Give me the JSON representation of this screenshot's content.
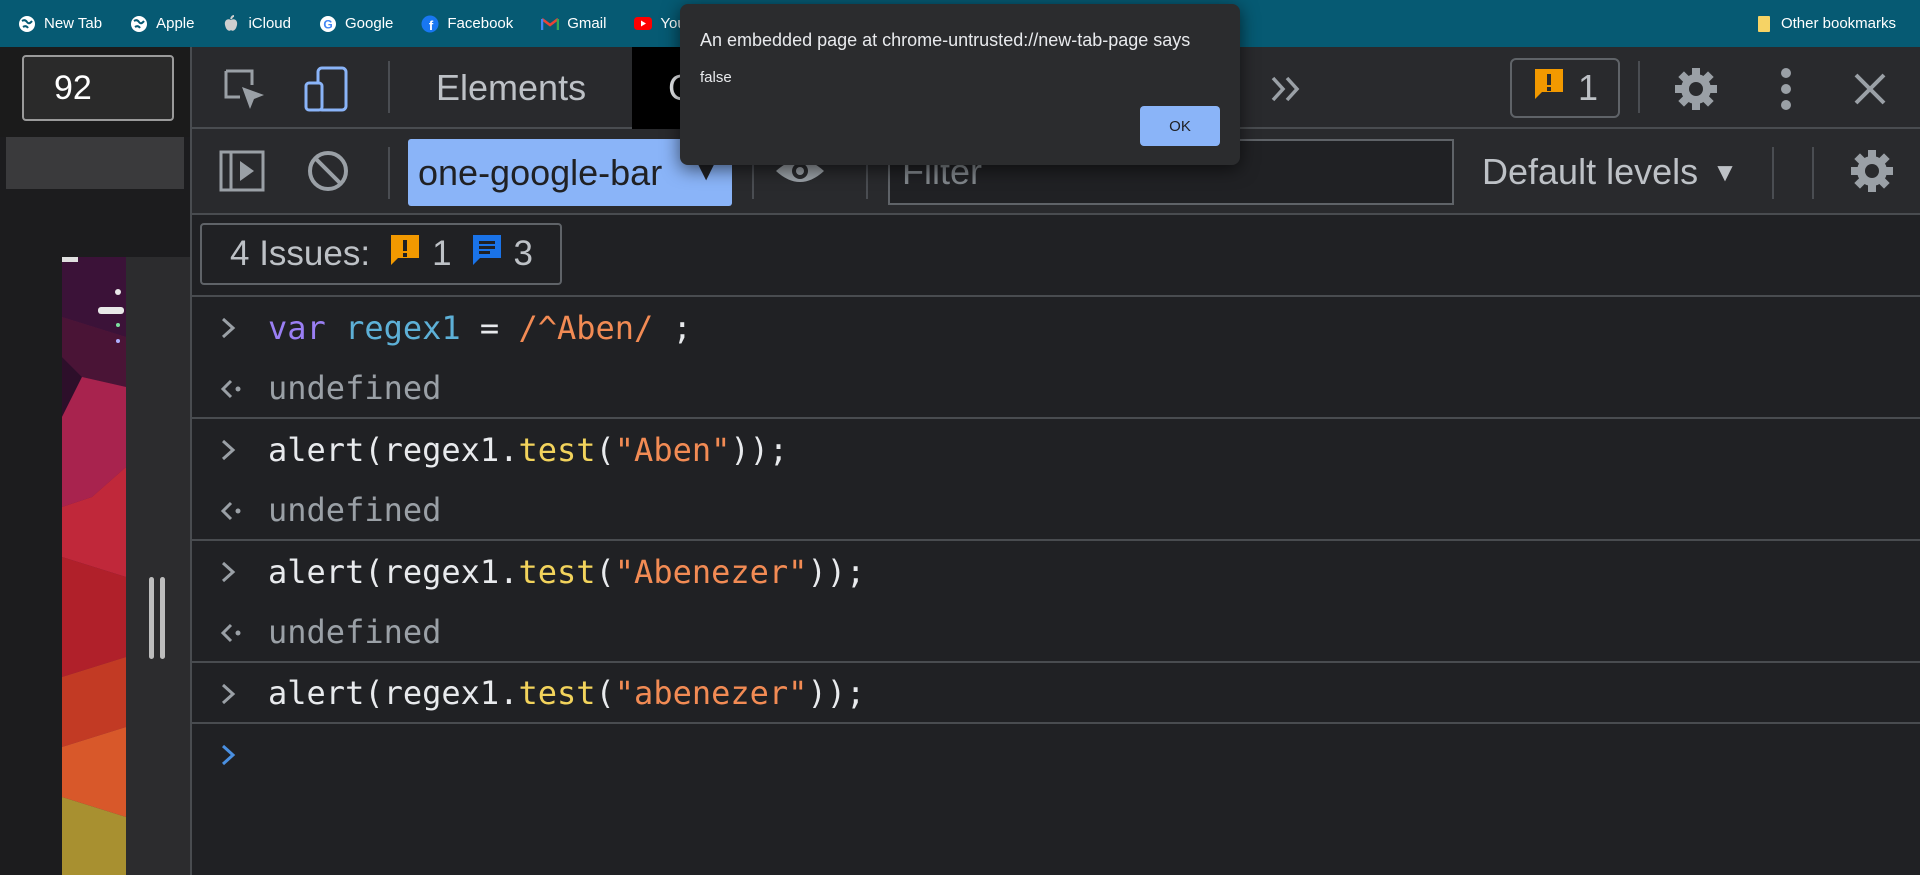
{
  "bookmarks": {
    "items": [
      {
        "label": "New Tab",
        "icon": "globe-icon"
      },
      {
        "label": "Apple",
        "icon": "globe-icon"
      },
      {
        "label": "iCloud",
        "icon": "apple-icon"
      },
      {
        "label": "Google",
        "icon": "google-icon"
      },
      {
        "label": "Facebook",
        "icon": "facebook-icon"
      },
      {
        "label": "Gmail",
        "icon": "gmail-icon"
      },
      {
        "label": "YouTu",
        "icon": "youtube-icon"
      }
    ],
    "other": "Other bookmarks"
  },
  "page": {
    "zoom_value": "92"
  },
  "devtools": {
    "tabs": [
      "Elements",
      "C"
    ],
    "issues_count": "1",
    "context": "one-google-bar",
    "filter_placeholder": "Filter",
    "levels_label": "Default levels",
    "issues_summary": {
      "label": "4 Issues:",
      "warnings": "1",
      "infos": "3"
    }
  },
  "console": {
    "entries": [
      {
        "type": "input",
        "tokens": [
          [
            "kw",
            "var"
          ],
          [
            "def",
            " "
          ],
          [
            "var",
            "regex1"
          ],
          [
            "def",
            " = "
          ],
          [
            "re",
            "/^Aben/"
          ],
          [
            "def",
            " ;"
          ]
        ]
      },
      {
        "type": "output",
        "text": "undefined"
      },
      {
        "type": "input",
        "tokens": [
          [
            "def",
            "alert(regex1."
          ],
          [
            "fn",
            "test"
          ],
          [
            "def",
            "("
          ],
          [
            "str",
            "\"Aben\""
          ],
          [
            "def",
            "));"
          ]
        ]
      },
      {
        "type": "output",
        "text": "undefined"
      },
      {
        "type": "input",
        "tokens": [
          [
            "def",
            "alert(regex1."
          ],
          [
            "fn",
            "test"
          ],
          [
            "def",
            "("
          ],
          [
            "str",
            "\"Abenezer\""
          ],
          [
            "def",
            "));"
          ]
        ]
      },
      {
        "type": "output",
        "text": "undefined"
      },
      {
        "type": "input",
        "tokens": [
          [
            "def",
            "alert(regex1."
          ],
          [
            "fn",
            "test"
          ],
          [
            "def",
            "("
          ],
          [
            "str",
            "\"abenezer\""
          ],
          [
            "def",
            "));"
          ]
        ]
      }
    ]
  },
  "dialog": {
    "title": "An embedded page at chrome-untrusted://new-tab-page says",
    "message": "false",
    "ok_label": "OK"
  },
  "colors": {
    "bookmark_bar": "#065a73",
    "accent": "#8ab4f8",
    "warning": "#f29900",
    "info": "#1a73e8"
  }
}
